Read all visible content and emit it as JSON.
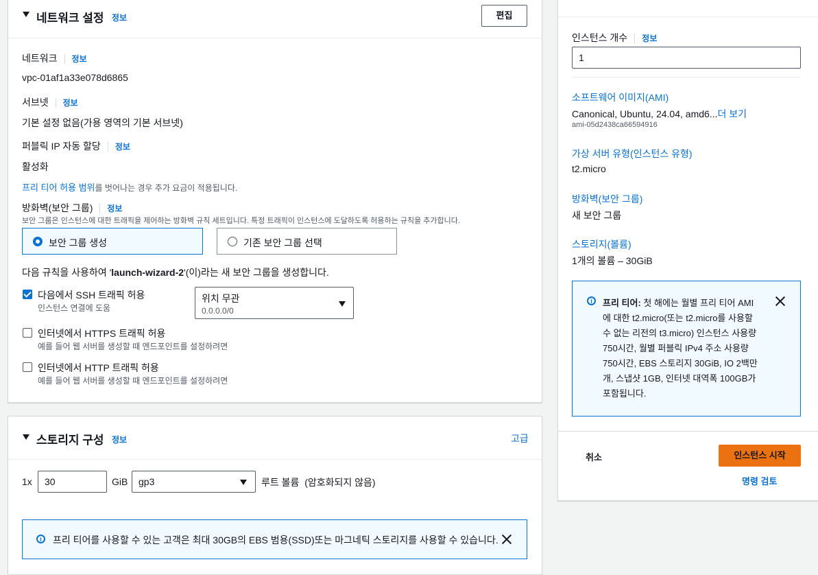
{
  "network": {
    "title": "네트워크 설정",
    "info": "정보",
    "edit_button": "편집",
    "network_label": "네트워크",
    "network_value": "vpc-01af1a33e078d6865",
    "subnet_label": "서브넷",
    "subnet_value": "기본 설정 없음(가용 영역의 기본 서브넷)",
    "public_ip_label": "퍼블릭 IP 자동 할당",
    "public_ip_value": "활성화",
    "free_tier_link": "프리 티어 허용 범위",
    "free_tier_text": "를 벗어나는 경우 추가 요금이 적용됩니다.",
    "firewall_label": "방화벽(보안 그룹)",
    "firewall_desc": "보안 그룹은 인스턴스에 대한 트래픽을 제어하는 방화벽 규칙 세트입니다. 특정 트래픽이 인스턴스에 도달하도록 허용하는 규칙을 추가합니다.",
    "option_create": "보안 그룹 생성",
    "option_existing": "기존 보안 그룹 선택",
    "rule_prefix": "다음 규칙을 사용하여 '",
    "rule_name": "launch-wizard-2",
    "rule_suffix": "'(이)라는 새 보안 그룹을 생성합니다.",
    "ssh": {
      "label": "다음에서 SSH 트래픽 허용",
      "desc": "인스턴스 연결에 도움",
      "checked": true
    },
    "ssh_source": {
      "label": "위치 무관",
      "value": "0.0.0.0/0"
    },
    "https": {
      "label": "인터넷에서 HTTPS 트래픽 허용",
      "desc": "예를 들어 웹 서버를 생성할 때 엔드포인트를 설정하려면",
      "checked": false
    },
    "http": {
      "label": "인터넷에서 HTTP 트래픽 허용",
      "desc": "예를 들어 웹 서버를 생성할 때 엔드포인트를 설정하려면",
      "checked": false
    }
  },
  "storage": {
    "title": "스토리지 구성",
    "info": "정보",
    "advanced": "고급",
    "count": "1x",
    "size": "30",
    "unit": "GiB",
    "type": "gp3",
    "root_label": "루트 볼륨",
    "encryption": "(암호화되지 않음)",
    "alert": "프리 티어를 사용할 수 있는 고객은 최대 30GB의 EBS 범용(SSD)또는 마그네틱 스토리지를 사용할 수 있습니다."
  },
  "summary": {
    "instance_count_label": "인스턴스 개수",
    "info": "정보",
    "instance_count": "1",
    "ami_label": "소프트웨어 이미지(AMI)",
    "ami_value": "Canonical, Ubuntu, 24.04, amd6...",
    "more": "더 보기",
    "ami_id": "ami-05d2438ca66594916",
    "type_label": "가상 서버 유형(인스턴스 유형)",
    "type_value": "t2.micro",
    "firewall_label": "방화벽(보안 그룹)",
    "firewall_value": "새 보안 그룹",
    "storage_label": "스토리지(볼륨)",
    "storage_value": "1개의 볼륨 – 30GiB",
    "free_tier_title": "프리 티어:",
    "free_tier_lines": [
      "첫 해에는 월별 프리 티어 AMI",
      "에 대한 t2.micro(또는 t2.micro를 사용할",
      "수 없는 리전의 t3.micro) 인스턴스 사용량",
      "750시간, 월별 퍼블릭 IPv4 주소 사용량",
      "750시간, EBS 스토리지 30GiB, IO 2백만",
      "개, 스냅샷 1GB, 인터넷 대역폭 100GB가",
      "포함됩니다."
    ],
    "cancel": "취소",
    "launch": "인스턴스 시작",
    "review": "명령 검토"
  }
}
